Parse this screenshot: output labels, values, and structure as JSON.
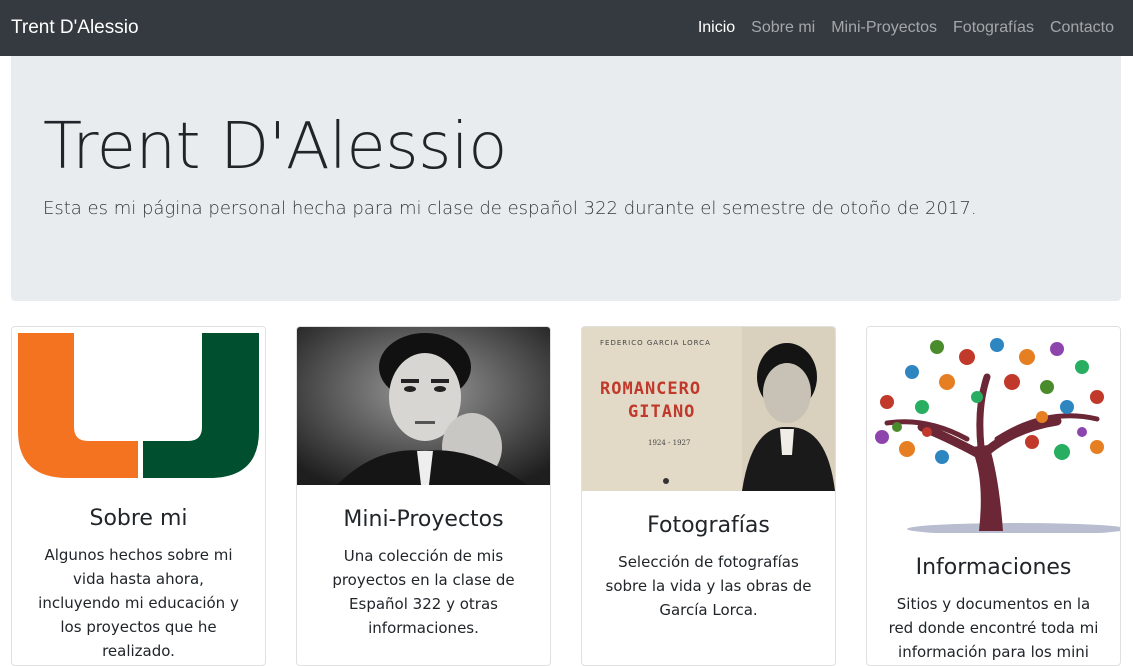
{
  "navbar": {
    "brand": "Trent D'Alessio",
    "links": [
      "Inicio",
      "Sobre mi",
      "Mini-Proyectos",
      "Fotografías",
      "Contacto"
    ]
  },
  "jumbotron": {
    "title": "Trent D'Alessio",
    "lead": "Esta es mi página personal hecha para mi clase de español 322 durante el semestre de otoño de 2017."
  },
  "cards": [
    {
      "title": "Sobre mi",
      "text": "Algunos hechos sobre mi vida hasta ahora, incluyendo mi educación y los proyectos que he realizado."
    },
    {
      "title": "Mini-Proyectos",
      "text": "Una colección de mis proyectos en la clase de Español 322 y otras informaciones."
    },
    {
      "title": "Fotografías",
      "text": "Selección de fotografías sobre la vida y las obras de García Lorca.",
      "book_title_line1": "ROMANCERO",
      "book_title_line2": "GITANO",
      "book_author": "FEDERICO GARCIA LORCA",
      "book_years": "1924 - 1927"
    },
    {
      "title": "Informaciones",
      "text": "Sitios y documentos en la red donde encontré toda mi información para los mini"
    }
  ],
  "colors": {
    "navbar_bg": "#343a40",
    "jumbotron_bg": "#e9ecef",
    "um_orange": "#f47321",
    "um_green": "#005030"
  }
}
